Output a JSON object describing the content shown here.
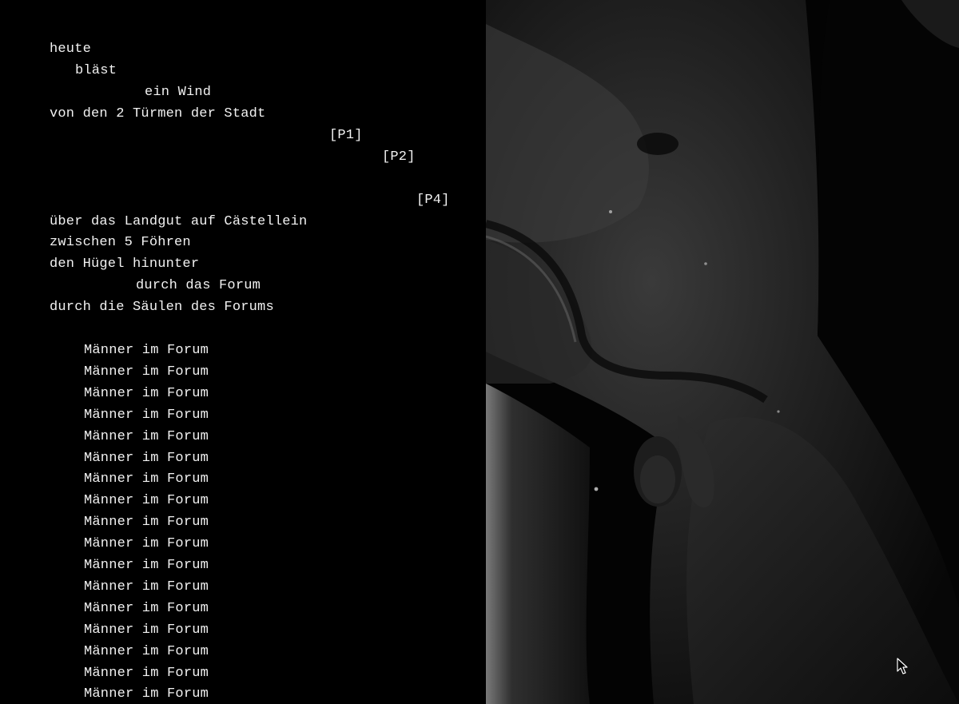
{
  "poem": {
    "lines": [
      "heute",
      "bläst",
      "ein Wind",
      "von den 2 Türmen der Stadt",
      "[P1]",
      "[P2]",
      "[P4]",
      "über das Landgut auf Cästellein",
      "zwischen 5 Föhren",
      "den Hügel hinunter",
      "durch das Forum",
      "durch die Säulen des Forums"
    ],
    "refrain": "Männer im Forum",
    "refrain_count": 17
  },
  "image": {
    "subject": "bronze-statue-torso",
    "tone_color": "#1a1a1a",
    "highlight_color": "#6d6d6d"
  },
  "cursor": {
    "icon": "pointer-arrow-icon"
  }
}
